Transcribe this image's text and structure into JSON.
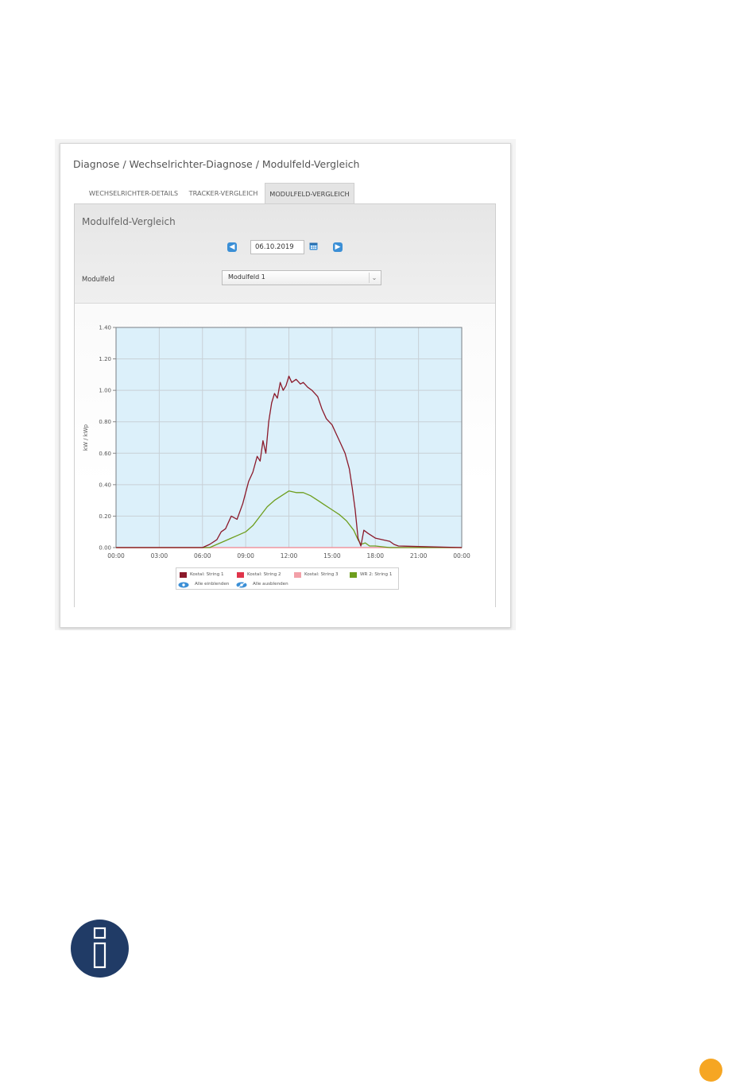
{
  "breadcrumb": "Diagnose / Wechselrichter-Diagnose / Modulfeld-Vergleich",
  "tabs": [
    {
      "label": "WECHSELRICHTER-DETAILS",
      "active": false
    },
    {
      "label": "TRACKER-VERGLEICH",
      "active": false
    },
    {
      "label": "MODULFELD-VERGLEICH",
      "active": true
    }
  ],
  "section_title": "Modulfeld-Vergleich",
  "date": {
    "value": "06.10.2019",
    "prev_icon": "chevron-left-icon",
    "next_icon": "chevron-right-icon",
    "calendar_icon": "calendar-icon"
  },
  "modulfeld": {
    "label": "Modulfeld",
    "selected": "Modulfeld 1"
  },
  "legend": {
    "series": [
      {
        "label": "Kostal: String 1",
        "color": "#8b1a2b"
      },
      {
        "label": "Kostal: String 2",
        "color": "#e0344a"
      },
      {
        "label": "Kostal: String 3",
        "color": "#f2a0a8"
      },
      {
        "label": "WR 2: String 1",
        "color": "#6e9e1e"
      }
    ],
    "show_all": "Alle einblenden",
    "hide_all": "Alle ausblenden"
  },
  "colors": {
    "plot_background": "#dcf0fa",
    "grid": "#c8d0d6",
    "accent": "#3b8fd6",
    "info_icon": "#203b66",
    "page_marker": "#f6a623"
  },
  "chart_data": {
    "type": "line",
    "title": "",
    "xlabel": "",
    "ylabel": "kW / kWp",
    "x_ticks": [
      "00:00",
      "03:00",
      "06:00",
      "09:00",
      "12:00",
      "15:00",
      "18:00",
      "21:00",
      "00:00"
    ],
    "y_ticks": [
      "0.00",
      "0.20",
      "0.40",
      "0.60",
      "0.80",
      "1.00",
      "1.20",
      "1.40"
    ],
    "xlim": [
      0,
      24
    ],
    "ylim": [
      0,
      1.4
    ],
    "grid": true,
    "legend_position": "bottom",
    "series": [
      {
        "name": "Kostal: String 1",
        "color": "#8b1a2b",
        "x": [
          0,
          6.0,
          6.5,
          7.0,
          7.3,
          7.6,
          8.0,
          8.4,
          8.8,
          9.2,
          9.5,
          9.8,
          10.0,
          10.2,
          10.4,
          10.6,
          10.8,
          11.0,
          11.2,
          11.4,
          11.6,
          11.8,
          12.0,
          12.2,
          12.5,
          12.8,
          13.0,
          13.3,
          13.6,
          14.0,
          14.3,
          14.6,
          15.0,
          15.3,
          15.6,
          15.9,
          16.2,
          16.4,
          16.6,
          16.8,
          17.0,
          17.2,
          17.5,
          18.0,
          18.5,
          19.0,
          19.3,
          19.6,
          24
        ],
        "y": [
          0.0,
          0.0,
          0.02,
          0.05,
          0.1,
          0.12,
          0.2,
          0.18,
          0.28,
          0.42,
          0.48,
          0.58,
          0.55,
          0.68,
          0.6,
          0.8,
          0.92,
          0.98,
          0.95,
          1.05,
          1.0,
          1.03,
          1.09,
          1.05,
          1.07,
          1.04,
          1.05,
          1.02,
          1.0,
          0.96,
          0.88,
          0.82,
          0.78,
          0.72,
          0.66,
          0.6,
          0.5,
          0.38,
          0.24,
          0.06,
          0.01,
          0.11,
          0.09,
          0.06,
          0.05,
          0.04,
          0.02,
          0.01,
          0.0
        ]
      },
      {
        "name": "Kostal: String 2",
        "color": "#e0344a",
        "x": [
          0,
          24
        ],
        "y": [
          0.0,
          0.0
        ]
      },
      {
        "name": "Kostal: String 3",
        "color": "#f2a0a8",
        "x": [
          0,
          24
        ],
        "y": [
          0.0,
          0.0
        ]
      },
      {
        "name": "WR 2: String 1",
        "color": "#6e9e1e",
        "x": [
          0,
          6.5,
          7.0,
          7.5,
          8.0,
          8.5,
          9.0,
          9.5,
          10.0,
          10.5,
          11.0,
          11.5,
          12.0,
          12.5,
          13.0,
          13.5,
          14.0,
          14.5,
          15.0,
          15.5,
          16.0,
          16.5,
          16.8,
          17.0,
          17.3,
          17.6,
          18.0,
          19.0,
          24
        ],
        "y": [
          0.0,
          0.0,
          0.02,
          0.04,
          0.06,
          0.08,
          0.1,
          0.14,
          0.2,
          0.26,
          0.3,
          0.33,
          0.36,
          0.35,
          0.35,
          0.33,
          0.3,
          0.27,
          0.24,
          0.21,
          0.17,
          0.11,
          0.05,
          0.02,
          0.03,
          0.01,
          0.01,
          0.0,
          0.0
        ]
      }
    ]
  }
}
